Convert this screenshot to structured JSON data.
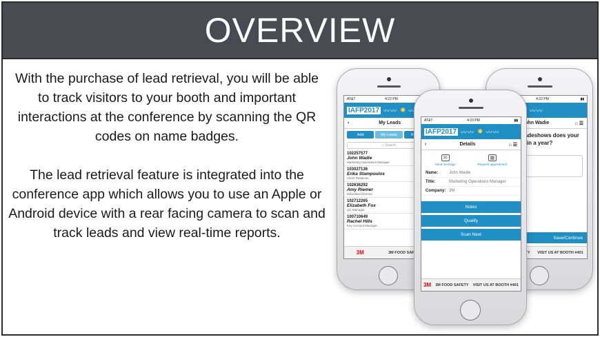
{
  "slide": {
    "title": "OVERVIEW",
    "paragraphs": [
      "With the purchase of lead retrieval, you will be able to track visitors to your booth and important interactions at the conference by scanning the QR codes on name badges.",
      "The lead retrieval feature is integrated into the conference app which allows you to use an Apple or Android device with a rear facing camera to scan and track leads and view real-time reports."
    ]
  },
  "app": {
    "logo": "IAFP2017",
    "carrier": "AT&T",
    "ad": {
      "brand": "3M",
      "text": "3M FOOD SAFETY",
      "booth": "VISIT US AT BOOTH #401"
    }
  },
  "phone_left": {
    "time": "4:22 PM",
    "nav_title": "My Leads",
    "tabs": [
      "Add",
      "My Leads",
      "Reports"
    ],
    "search_placeholder": "Search",
    "leads": [
      {
        "id": "102257577",
        "name": "John Wadie",
        "role": "Marketing Operations Manager"
      },
      {
        "id": "103027136",
        "name": "Erika Stampoulos",
        "role": "Client Relations"
      },
      {
        "id": "102636292",
        "name": "Amy Riemer",
        "role": "Education Director"
      },
      {
        "id": "102712265",
        "name": "Elizabeth Fox",
        "role": "QC Manager"
      },
      {
        "id": "100710649",
        "name": "Rachel Hills",
        "role": "Key Account Manager"
      }
    ]
  },
  "phone_right": {
    "time": "4:22 PM",
    "nav_title": "John Wadie",
    "question": "tradeshows does your ... in a year?",
    "save_label": "Save/Continue"
  },
  "phone_center": {
    "time": "4:23 PM",
    "nav_title": "Details",
    "actions": [
      "Send message",
      "Request appointment"
    ],
    "fields": [
      {
        "label": "Name:",
        "value": "John Wadie"
      },
      {
        "label": "Title:",
        "value": "Marketing Operations Manager"
      },
      {
        "label": "Company:",
        "value": "3M"
      }
    ],
    "buttons": [
      "Notes",
      "Qualify",
      "Scan Next"
    ]
  },
  "colors": {
    "banner": "#4a4a52",
    "accent": "#1f8fc4"
  }
}
